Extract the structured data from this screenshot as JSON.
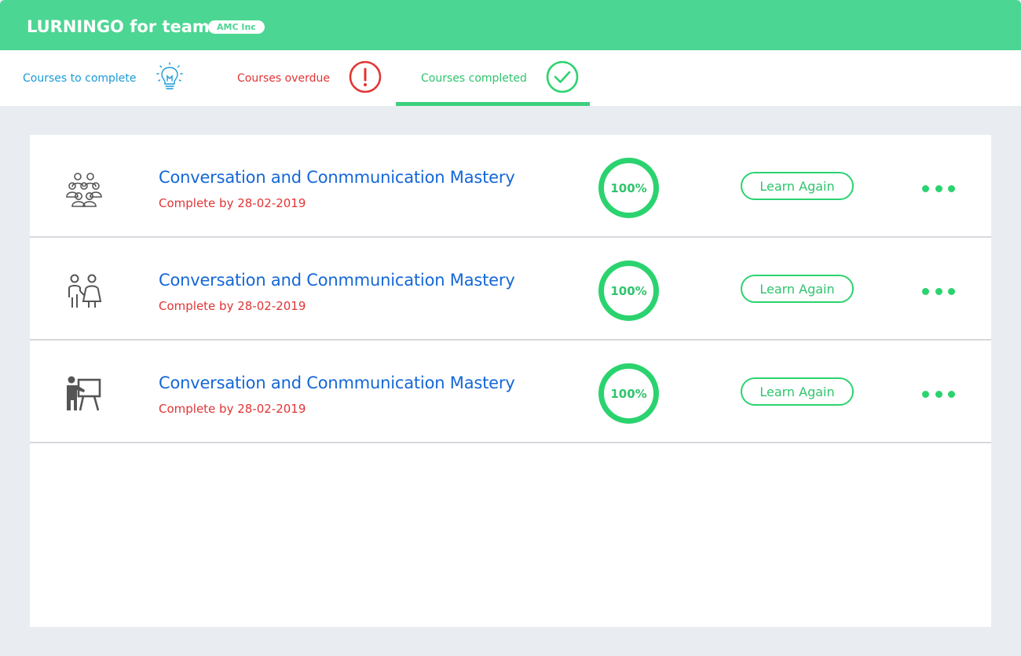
{
  "app": {
    "brand": "LURNINGO for teams",
    "org_badge": "AMC Inc"
  },
  "colors": {
    "header_green": "#4cd693",
    "accent_green": "#2bd36f",
    "blue_link": "#1467d8",
    "red_alert": "#e03535",
    "tab_blue": "#1a9ad6"
  },
  "tabs": [
    {
      "label": "Courses to complete",
      "icon": "lightbulb-icon",
      "active": false
    },
    {
      "label": "Courses overdue",
      "icon": "exclamation-circle-icon",
      "active": false
    },
    {
      "label": "Courses completed",
      "icon": "checkmark-circle-icon",
      "active": true
    }
  ],
  "courses": [
    {
      "icon": "group-people-icon",
      "title": "Conversation and Conmmunication Mastery",
      "due": "Complete by 28-02-2019",
      "progress": 100,
      "progress_label": "100%",
      "action": "Learn Again"
    },
    {
      "icon": "couple-icon",
      "title": "Conversation and Conmmunication Mastery",
      "due": "Complete by 28-02-2019",
      "progress": 100,
      "progress_label": "100%",
      "action": "Learn Again"
    },
    {
      "icon": "presenter-board-icon",
      "title": "Conversation and Conmmunication Mastery",
      "due": "Complete by 28-02-2019",
      "progress": 100,
      "progress_label": "100%",
      "action": "Learn Again"
    }
  ]
}
